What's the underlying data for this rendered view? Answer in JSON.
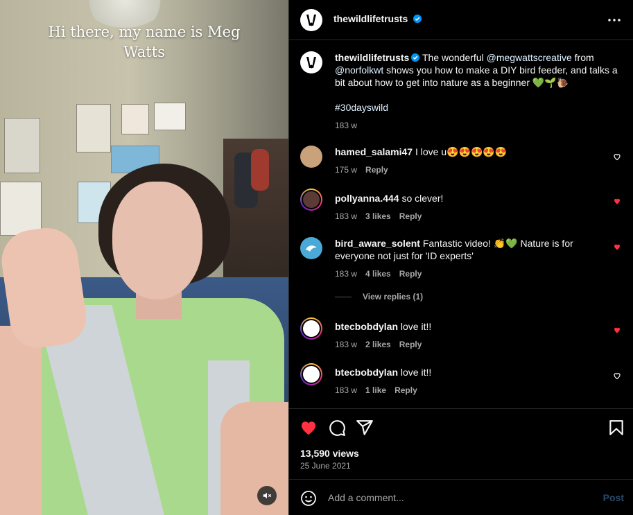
{
  "video": {
    "caption": "Hi there, my name is Meg Watts",
    "mute_icon": "speaker-muted-icon"
  },
  "header": {
    "username": "thewildlifetrusts",
    "more_icon": "more-horizontal-icon"
  },
  "post": {
    "username": "thewildlifetrusts",
    "caption_before": " The wonderful ",
    "mention_1": "@megwattscreative",
    "caption_mid": " from ",
    "mention_2": "@norfolkwt",
    "caption_after": " shows you how to make a DIY bird feeder, and talks a bit about how to get into nature as a beginner 💚🌱🐌",
    "hashtag": "#30dayswild",
    "time": "183 w"
  },
  "comments": [
    {
      "username": "hamed_salami47",
      "text": " I love u😍😍😍😍😍",
      "time": "175 w",
      "likes": "",
      "reply": "Reply",
      "liked": false,
      "avatar_color": "#c9a17a"
    },
    {
      "username": "pollyanna.444",
      "text": " so clever!",
      "time": "183 w",
      "likes": "3 likes",
      "reply": "Reply",
      "liked": true,
      "avatar_color": "#5a3b36"
    },
    {
      "username": "bird_aware_solent",
      "text": " Fantastic video! 👏💚 Nature is for everyone not just for 'ID experts'",
      "time": "183 w",
      "likes": "4 likes",
      "reply": "Reply",
      "liked": true,
      "avatar_color": "#4aa9d6",
      "avatar_text": "Bird Aware Solent"
    },
    {
      "username": "btecbobdylan",
      "text": " love it!!",
      "time": "183 w",
      "likes": "2 likes",
      "reply": "Reply",
      "liked": true,
      "avatar_color": "#ffffff"
    },
    {
      "username": "btecbobdylan",
      "text": " love it!!",
      "time": "183 w",
      "likes": "1 like",
      "reply": "Reply",
      "liked": false,
      "avatar_color": "#ffffff"
    }
  ],
  "view_replies": "View replies (1)",
  "actions": {
    "like_icon": "heart-filled-icon",
    "comment_icon": "comment-bubble-icon",
    "share_icon": "paper-plane-icon",
    "save_icon": "bookmark-icon",
    "views": "13,590 views",
    "date": "25 June 2021"
  },
  "comment_bar": {
    "emoji_icon": "emoji-smile-icon",
    "placeholder": "Add a comment...",
    "post_label": "Post"
  },
  "colors": {
    "like_red": "#ff3040",
    "link": "#e0f1ff",
    "verified_blue": "#0095f6",
    "muted_text": "#a8a8a8"
  }
}
